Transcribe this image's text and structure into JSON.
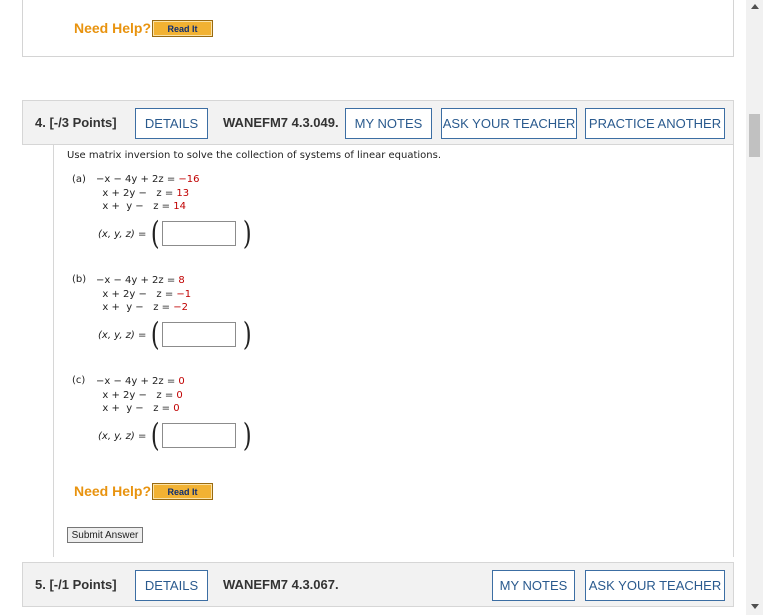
{
  "top_section": {
    "need_help": "Need Help?",
    "read_it": "Read It"
  },
  "question4": {
    "label": "4. [-/3 Points]",
    "details": "DETAILS",
    "code": "WANEFM7 4.3.049.",
    "my_notes": "MY NOTES",
    "ask_teacher": "ASK YOUR TEACHER",
    "practice_another": "PRACTICE ANOTHER",
    "prompt": "Use matrix inversion to solve the collection of systems of linear equations.",
    "parts": [
      {
        "label": "(a)",
        "equations": [
          {
            "lhs": "−x − 4y + 2z =",
            "rhs": "−16"
          },
          {
            "lhs": "  x + 2y −   z =",
            "rhs": "13"
          },
          {
            "lhs": "  x +  y −   z =",
            "rhs": "14"
          }
        ],
        "answer_label": "(x, y, z) =",
        "answer_value": ""
      },
      {
        "label": "(b)",
        "equations": [
          {
            "lhs": "−x − 4y + 2z =",
            "rhs": "8"
          },
          {
            "lhs": "  x + 2y −   z =",
            "rhs": "−1"
          },
          {
            "lhs": "  x +  y −   z =",
            "rhs": "−2"
          }
        ],
        "answer_label": "(x, y, z) =",
        "answer_value": ""
      },
      {
        "label": "(c)",
        "equations": [
          {
            "lhs": "−x − 4y + 2z =",
            "rhs": "0"
          },
          {
            "lhs": "  x + 2y −   z =",
            "rhs": "0"
          },
          {
            "lhs": "  x +  y −   z =",
            "rhs": "0"
          }
        ],
        "answer_label": "(x, y, z) =",
        "answer_value": ""
      }
    ],
    "need_help": "Need Help?",
    "read_it": "Read It",
    "submit": "Submit Answer"
  },
  "question5": {
    "label": "5. [-/1 Points]",
    "details": "DETAILS",
    "code": "WANEFM7 4.3.067.",
    "my_notes": "MY NOTES",
    "ask_teacher": "ASK YOUR TEACHER"
  },
  "colors": {
    "need_help": "#e8930f",
    "read_it_bg": "#f2b233",
    "button_border": "#3c6ea3",
    "rhs_red": "#c00000"
  }
}
